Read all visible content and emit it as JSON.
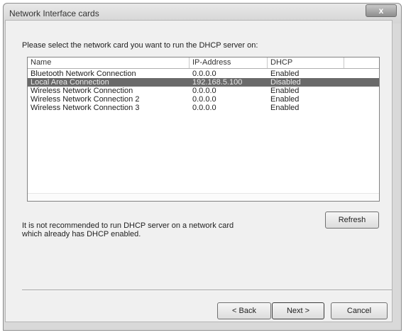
{
  "window": {
    "title": "Network Interface cards",
    "close_symbol": "x"
  },
  "prompt": "Please select the network card you want to run the DHCP server on:",
  "table": {
    "columns": [
      "Name",
      "IP-Address",
      "DHCP"
    ],
    "rows": [
      {
        "name": "Bluetooth Network Connection",
        "ip": "0.0.0.0",
        "dhcp": "Enabled",
        "selected": false
      },
      {
        "name": "Local Area Connection",
        "ip": "192.168.5.100",
        "dhcp": "Disabled",
        "selected": true
      },
      {
        "name": "Wireless Network Connection",
        "ip": "0.0.0.0",
        "dhcp": "Enabled",
        "selected": false
      },
      {
        "name": "Wireless Network Connection 2",
        "ip": "0.0.0.0",
        "dhcp": "Enabled",
        "selected": false
      },
      {
        "name": "Wireless Network Connection 3",
        "ip": "0.0.0.0",
        "dhcp": "Enabled",
        "selected": false
      }
    ]
  },
  "warning": {
    "line1": "It is not recommended to run DHCP server on a network card",
    "line2": "which already has DHCP enabled."
  },
  "buttons": {
    "refresh": "Refresh",
    "back": "< Back",
    "next": "Next >",
    "cancel": "Cancel"
  },
  "icons": {
    "close": "close-icon"
  },
  "colors": {
    "selection": "#6a6a6a",
    "dialog_bg": "#f0f0f0"
  }
}
